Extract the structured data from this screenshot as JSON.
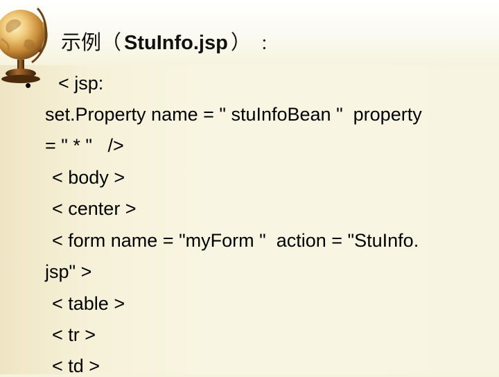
{
  "slide": {
    "title": {
      "prefix": "示例（",
      "main": "StuInfo.jsp",
      "suffix": "）",
      "colon": "："
    },
    "bullet_char": "•",
    "code_lines": [
      "< jsp:",
      "set.Property name = \" stuInfoBean \"  property",
      "= \" * \"   />",
      "< body >",
      "< center >",
      "< form name = \"myForm \"  action = \"StuInfo.",
      "jsp\" >",
      "< table >",
      "< tr >",
      "< td >"
    ]
  },
  "colors": {
    "background": "#f6f3dd",
    "text": "#000000"
  },
  "icons": {
    "decor": "globe-icon"
  }
}
